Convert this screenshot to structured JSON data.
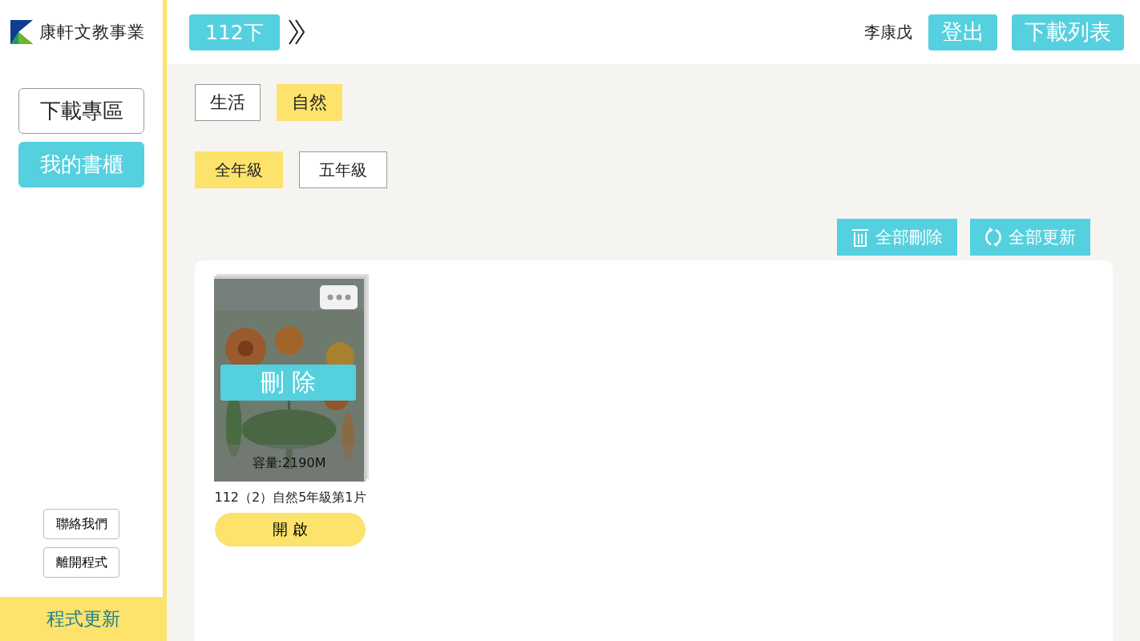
{
  "sidebar": {
    "brand": "康軒文教事業",
    "nav": [
      {
        "label": "下載專區",
        "selected": false
      },
      {
        "label": "我的書櫃",
        "selected": true
      }
    ],
    "links": [
      "聯絡我們",
      "離開程式"
    ],
    "update": "程式更新"
  },
  "header": {
    "term": "112下",
    "user": "李康戊",
    "buttons": [
      "登出",
      "下載列表"
    ]
  },
  "subjects": [
    {
      "label": "生活",
      "selected": false
    },
    {
      "label": "自然",
      "selected": true
    }
  ],
  "grades": [
    {
      "label": "全年級",
      "selected": true
    },
    {
      "label": "五年級",
      "selected": false
    }
  ],
  "actions": [
    {
      "kind": "delete",
      "label": "全部刪除"
    },
    {
      "kind": "refresh",
      "label": "全部更新"
    }
  ],
  "books": [
    {
      "delete_label": "刪 除",
      "size": "容量:2190M",
      "title": "112（2）自然5年級第1片",
      "open_label": "開 啟"
    }
  ]
}
